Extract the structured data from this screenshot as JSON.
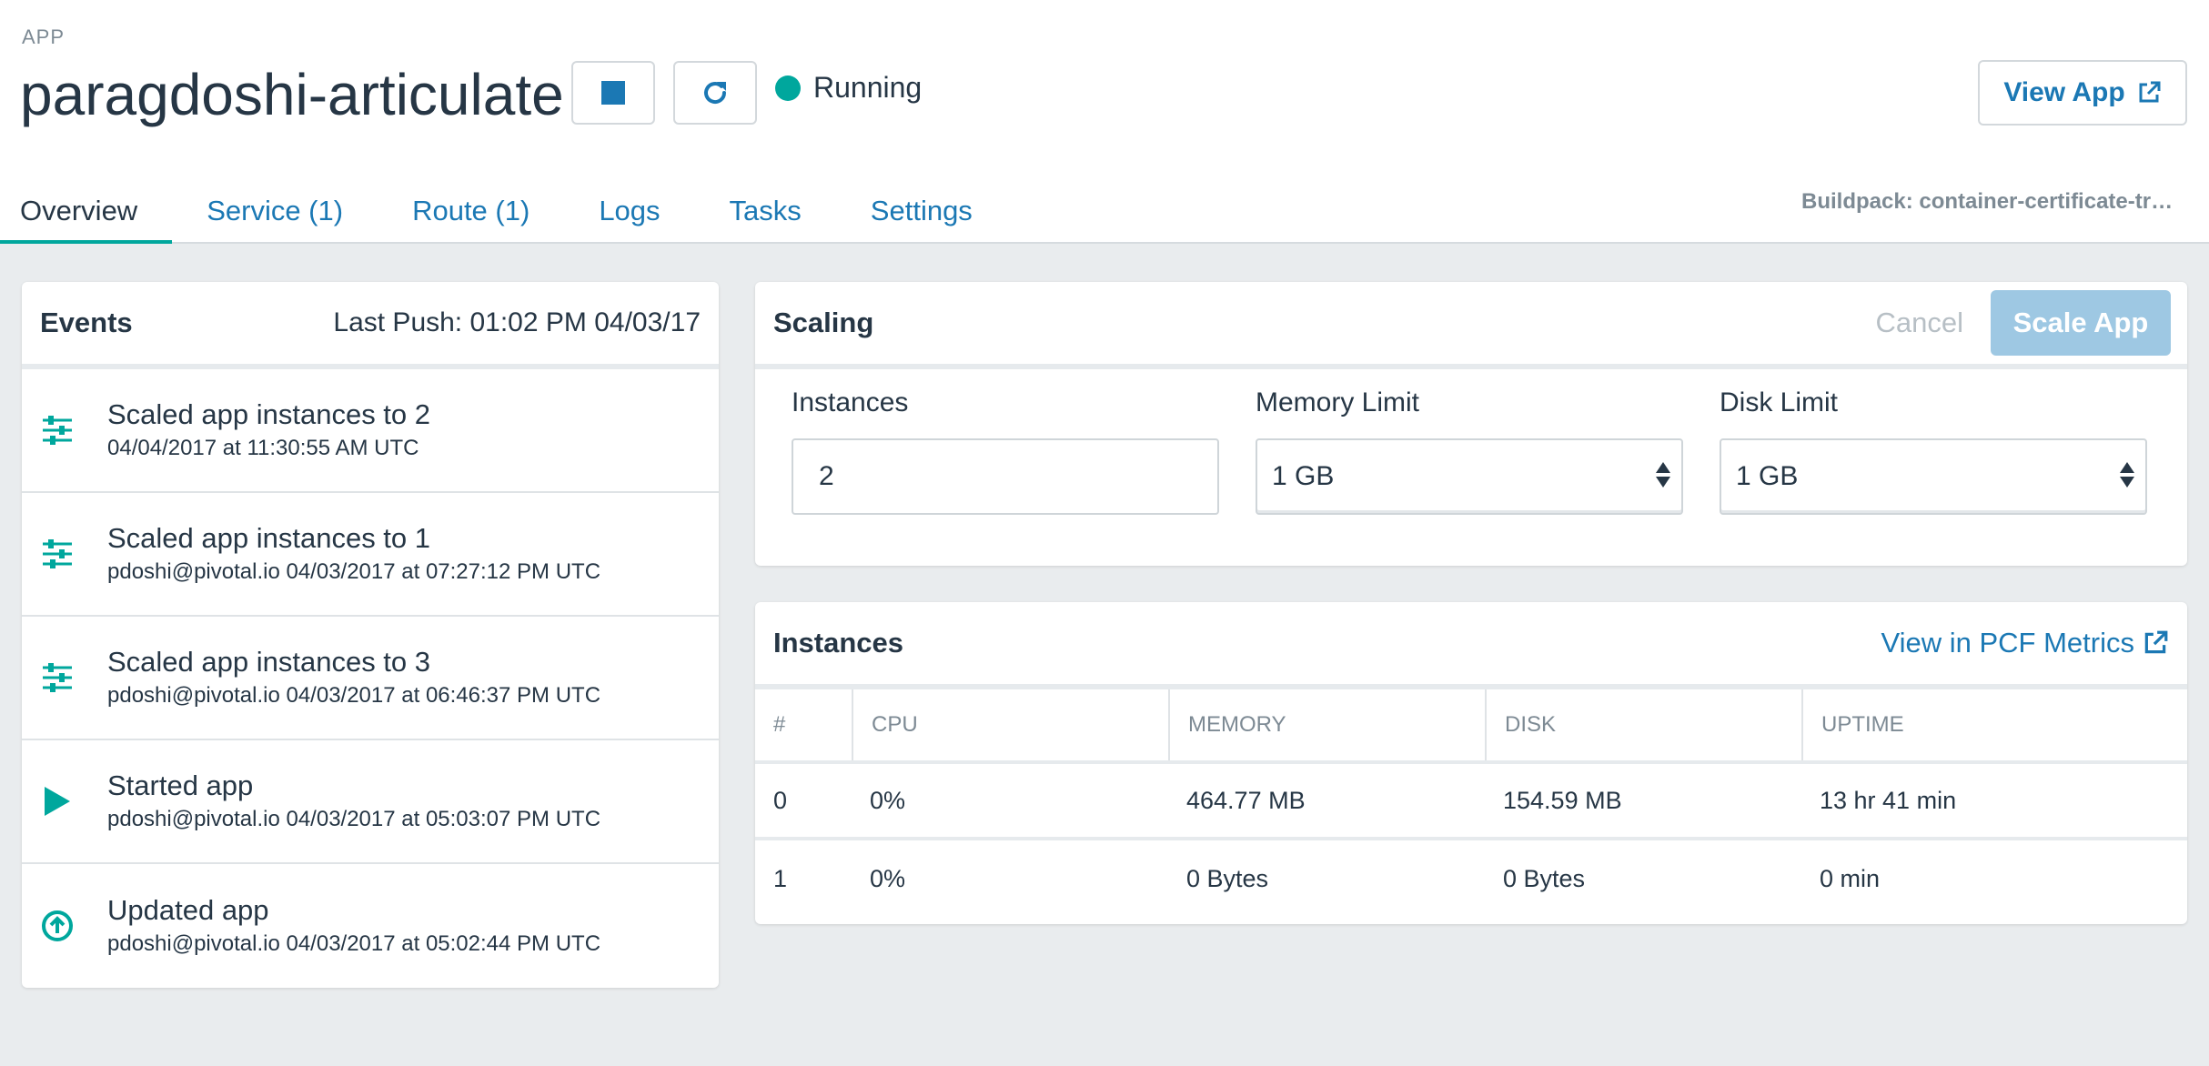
{
  "header": {
    "kicker": "APP",
    "app_name": "paragdoshi-articulate",
    "status": "Running",
    "view_app_label": "View App",
    "buildpack": "Buildpack: container-certificate-trust-store"
  },
  "tabs": [
    "Overview",
    "Service (1)",
    "Route (1)",
    "Logs",
    "Tasks",
    "Settings"
  ],
  "events": {
    "title": "Events",
    "last_push": "Last Push: 01:02 PM 04/03/17",
    "items": [
      {
        "title": "Scaled app instances to 2",
        "sub": "04/04/2017 at 11:30:55 AM UTC",
        "icon": "sliders-icon"
      },
      {
        "title": "Scaled app instances to 1",
        "sub": "pdoshi@pivotal.io 04/03/2017 at 07:27:12 PM UTC",
        "icon": "sliders-icon"
      },
      {
        "title": "Scaled app instances to 3",
        "sub": "pdoshi@pivotal.io 04/03/2017 at 06:46:37 PM UTC",
        "icon": "sliders-icon"
      },
      {
        "title": "Started app",
        "sub": "pdoshi@pivotal.io 04/03/2017 at 05:03:07 PM UTC",
        "icon": "play-icon"
      },
      {
        "title": "Updated app",
        "sub": "pdoshi@pivotal.io 04/03/2017 at 05:02:44 PM UTC",
        "icon": "upload-icon"
      }
    ]
  },
  "scaling": {
    "title": "Scaling",
    "cancel_label": "Cancel",
    "scale_label": "Scale App",
    "instances_label": "Instances",
    "instances_value": "2",
    "memory_label": "Memory Limit",
    "memory_value": "1 GB",
    "disk_label": "Disk Limit",
    "disk_value": "1 GB"
  },
  "instances": {
    "title": "Instances",
    "metrics_link": "View in PCF Metrics",
    "columns": [
      "#",
      "CPU",
      "MEMORY",
      "DISK",
      "UPTIME"
    ],
    "rows": [
      [
        "0",
        "0%",
        "464.77 MB",
        "154.59 MB",
        "13 hr 41 min"
      ],
      [
        "1",
        "0%",
        "0 Bytes",
        "0 Bytes",
        "0 min"
      ]
    ]
  },
  "colors": {
    "accent": "#00a79d",
    "link": "#1b78b4",
    "primary_disabled": "#9ec8e3"
  }
}
